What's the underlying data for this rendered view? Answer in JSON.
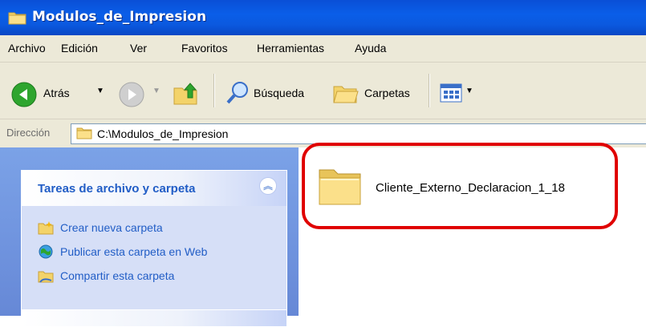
{
  "window": {
    "title": "Modulos_de_Impresion"
  },
  "menu": {
    "items": [
      "Archivo",
      "Edición",
      "Ver",
      "Favoritos",
      "Herramientas",
      "Ayuda"
    ]
  },
  "toolbar": {
    "back_label": "Atrás",
    "search_label": "Búsqueda",
    "folders_label": "Carpetas"
  },
  "address": {
    "label": "Dirección",
    "path": "C:\\Modulos_de_Impresion"
  },
  "tasks_panel": {
    "title": "Tareas de archivo y carpeta",
    "items": [
      {
        "label": "Crear nueva carpeta",
        "icon": "new-folder-icon"
      },
      {
        "label": "Publicar esta carpeta en Web",
        "icon": "publish-web-icon"
      },
      {
        "label": "Compartir esta carpeta",
        "icon": "share-folder-icon"
      }
    ]
  },
  "files": [
    {
      "name": "Cliente_Externo_Declaracion_1_18",
      "icon": "folder-icon"
    }
  ],
  "colors": {
    "title_bar": "#0a5ee8",
    "task_link": "#215dc6",
    "highlight": "#e00000",
    "chrome": "#ece9d8"
  }
}
